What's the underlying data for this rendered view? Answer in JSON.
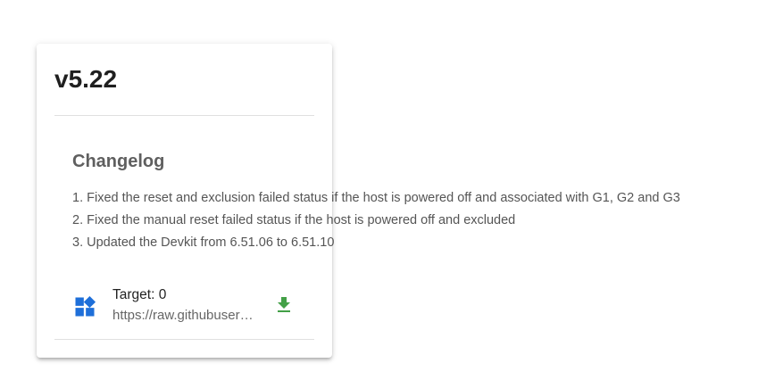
{
  "release": {
    "version": "v5.22"
  },
  "changelog": {
    "heading": "Changelog",
    "items": [
      "1. Fixed the reset and exclusion failed status if the host is powered off and associated with G1, G2 and G3",
      "2. Fixed the manual reset failed status if the host is powered off and excluded",
      "3. Updated the Devkit from 6.51.06 to 6.51.10"
    ]
  },
  "asset": {
    "target": "Target: 0",
    "url": "https://raw.githubusercontent.com",
    "icon": "widgets-icon",
    "download_icon": "download-icon"
  },
  "colors": {
    "title": "#1f1f1f",
    "heading": "#5f5f5f",
    "body_text": "#555555",
    "asset_icon": "#1e6fd9",
    "download_icon": "#43a047",
    "divider": "#e0e0e0"
  }
}
